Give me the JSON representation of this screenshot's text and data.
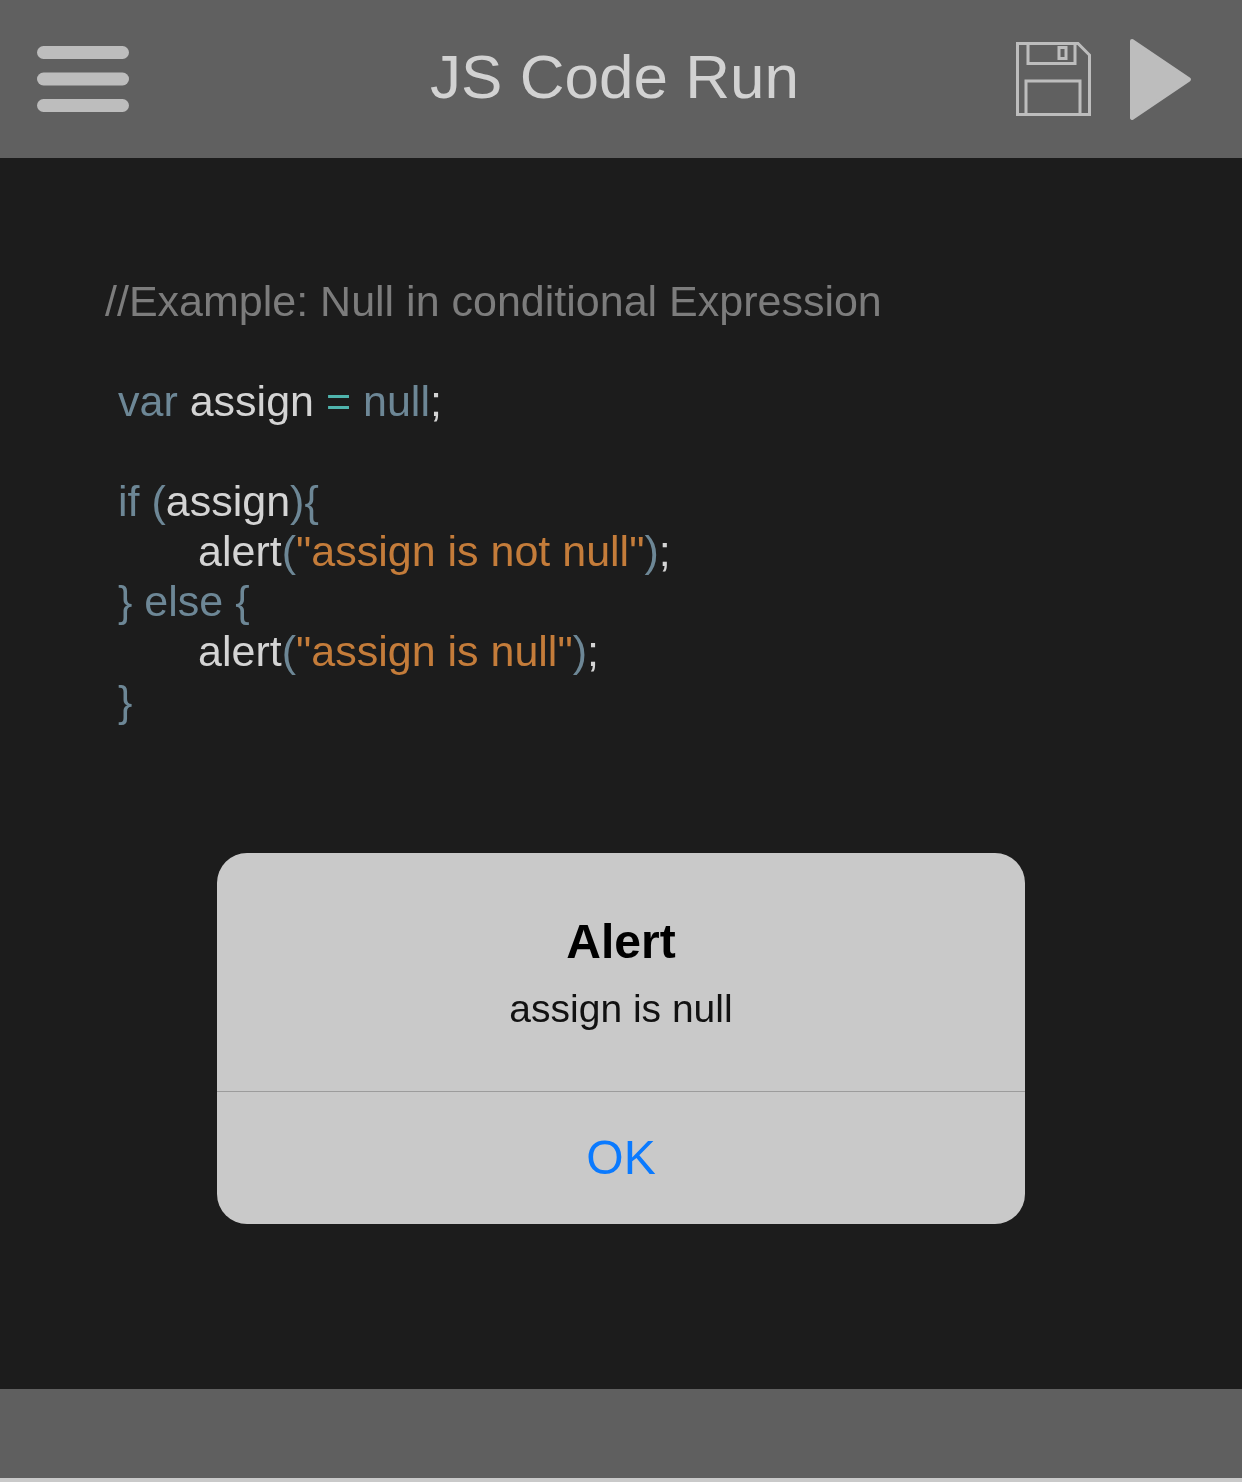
{
  "header": {
    "title": "JS Code Run"
  },
  "editor": {
    "blocks": [
      {
        "kind": "comment",
        "lines": [
          {
            "tokens": [
              {
                "kind": "comment",
                "text": "//Example: Null in conditional Expression"
              }
            ]
          }
        ]
      },
      {
        "kind": "code",
        "lines": [
          {
            "tokens": [
              {
                "kind": "keyword",
                "text": "var"
              },
              {
                "kind": "identifier",
                "text": " assign "
              },
              {
                "kind": "operator",
                "text": "="
              },
              {
                "kind": "keyword",
                "text": " null"
              },
              {
                "kind": "plain",
                "text": ";"
              }
            ]
          }
        ]
      },
      {
        "kind": "code",
        "lines": [
          {
            "tokens": [
              {
                "kind": "keyword",
                "text": "if ("
              },
              {
                "kind": "identifier",
                "text": "assign"
              },
              {
                "kind": "keyword",
                "text": "){"
              }
            ],
            "children": [
              {
                "tokens": [
                  {
                    "kind": "identifier",
                    "text": "alert"
                  },
                  {
                    "kind": "keyword",
                    "text": "("
                  },
                  {
                    "kind": "string",
                    "text": "\"assign is not null\""
                  },
                  {
                    "kind": "keyword",
                    "text": ")"
                  },
                  {
                    "kind": "plain",
                    "text": ";"
                  }
                ]
              }
            ]
          },
          {
            "tokens": [
              {
                "kind": "keyword",
                "text": "} else {"
              }
            ],
            "children": [
              {
                "tokens": [
                  {
                    "kind": "identifier",
                    "text": "alert"
                  },
                  {
                    "kind": "keyword",
                    "text": "("
                  },
                  {
                    "kind": "string",
                    "text": "\"assign is null\""
                  },
                  {
                    "kind": "keyword",
                    "text": ")"
                  },
                  {
                    "kind": "plain",
                    "text": ";"
                  }
                ]
              }
            ]
          },
          {
            "tokens": [
              {
                "kind": "keyword",
                "text": "}"
              }
            ]
          }
        ]
      }
    ]
  },
  "alert": {
    "title": "Alert",
    "message": "assign is null",
    "buttons": [
      "OK"
    ]
  }
}
